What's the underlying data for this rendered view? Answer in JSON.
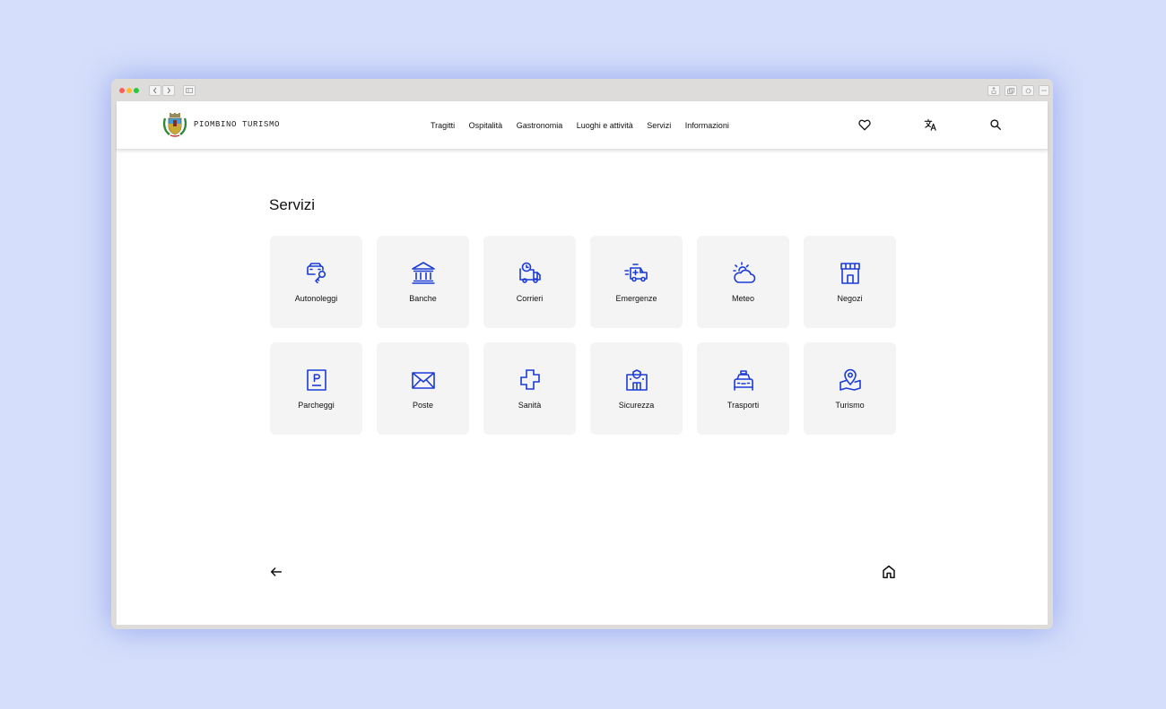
{
  "header": {
    "brand_name": "PIOMBINO TURISMO",
    "nav": [
      "Tragitti",
      "Ospitalità",
      "Gastronomia",
      "Luoghi e attività",
      "Servizi",
      "Informazioni"
    ],
    "icons": [
      "heart-icon",
      "translate-icon",
      "search-icon"
    ]
  },
  "main": {
    "title": "Servizi",
    "services": [
      {
        "label": "Autonoleggi",
        "icon": "car-key-icon"
      },
      {
        "label": "Banche",
        "icon": "bank-icon"
      },
      {
        "label": "Corrieri",
        "icon": "delivery-truck-icon"
      },
      {
        "label": "Emergenze",
        "icon": "ambulance-icon"
      },
      {
        "label": "Meteo",
        "icon": "weather-icon"
      },
      {
        "label": "Negozi",
        "icon": "shop-icon"
      },
      {
        "label": "Parcheggi",
        "icon": "parking-icon"
      },
      {
        "label": "Poste",
        "icon": "mail-icon"
      },
      {
        "label": "Sanità",
        "icon": "health-cross-icon"
      },
      {
        "label": "Sicurezza",
        "icon": "police-station-icon"
      },
      {
        "label": "Trasporti",
        "icon": "taxi-icon"
      },
      {
        "label": "Turismo",
        "icon": "map-pin-icon"
      }
    ]
  },
  "footer": {
    "icons": [
      "arrow-left-icon",
      "home-icon"
    ]
  },
  "colors": {
    "background": "#d5defa",
    "accent": "#1b3bd6",
    "tile": "#f4f4f4",
    "text": "#111111"
  }
}
